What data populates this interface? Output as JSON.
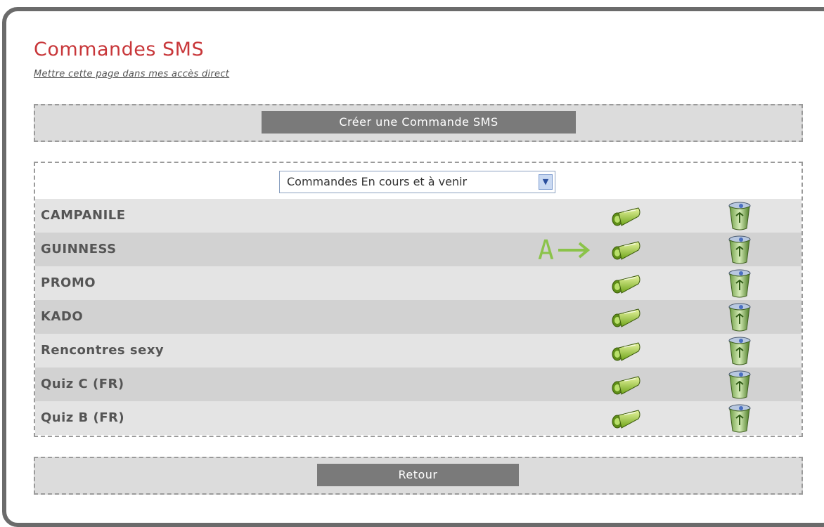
{
  "page": {
    "title": "Commandes SMS",
    "direct_link": "Mettre cette page dans mes accès direct"
  },
  "actions": {
    "create_label": "Créer une Commande SMS",
    "back_label": "Retour"
  },
  "filter": {
    "selected": "Commandes En cours et à venir"
  },
  "commands": [
    {
      "name": "CAMPANILE"
    },
    {
      "name": "GUINNESS"
    },
    {
      "name": "PROMO"
    },
    {
      "name": "KADO"
    },
    {
      "name": "Rencontres sexy"
    },
    {
      "name": "Quiz C (FR)"
    },
    {
      "name": "Quiz B (FR)"
    }
  ],
  "annotation": {
    "label": "A",
    "color": "#8bc34a"
  },
  "icons": {
    "edit": "edit-pen-icon",
    "delete": "trash-bin-icon"
  }
}
